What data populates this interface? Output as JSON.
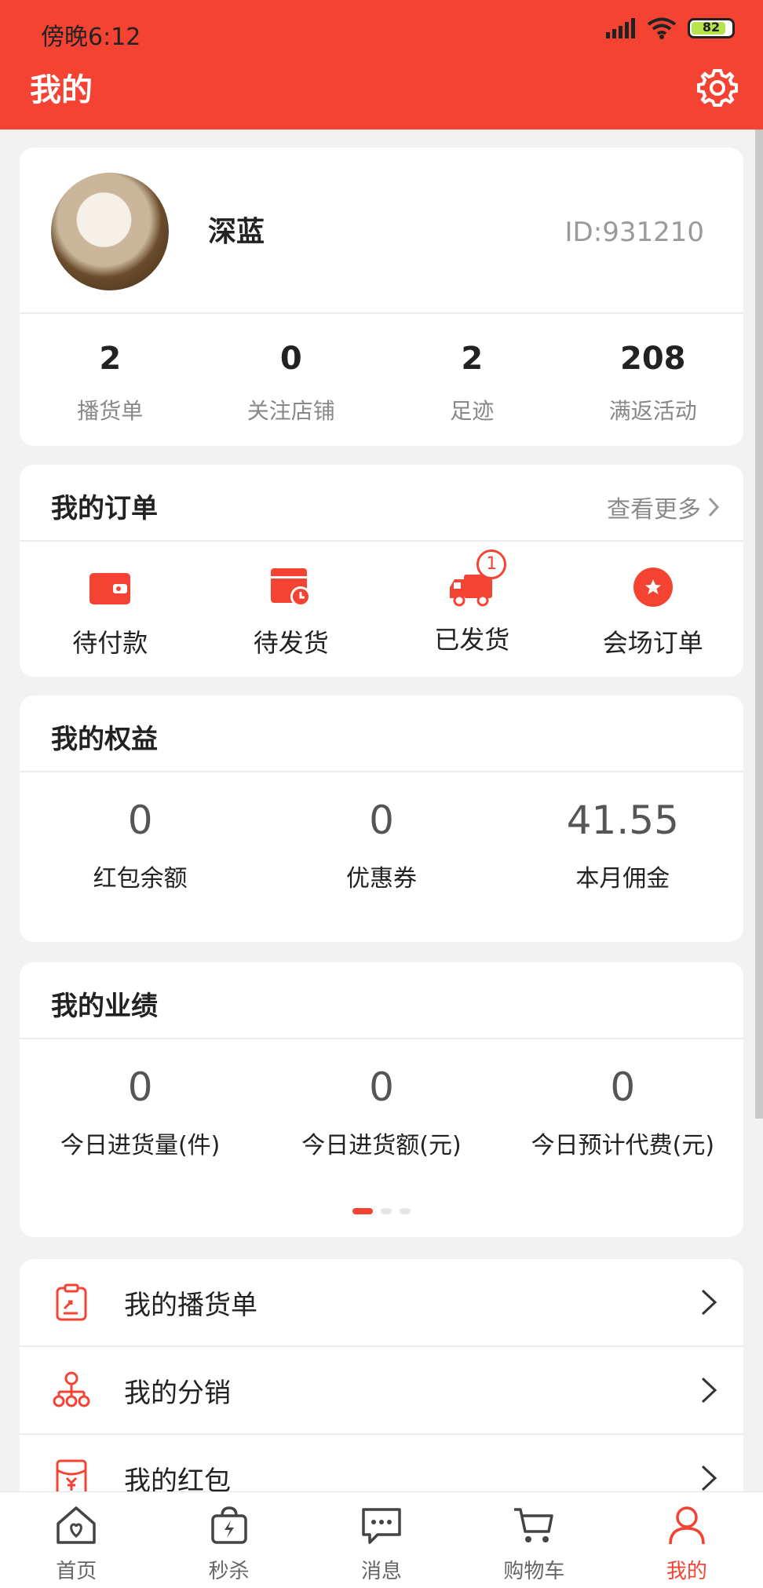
{
  "status_bar": {
    "time": "傍晚6:12",
    "battery": "82"
  },
  "header": {
    "title": "我的"
  },
  "profile": {
    "name": "深蓝",
    "id": "ID:931210",
    "stats": [
      {
        "value": "2",
        "label": "播货单"
      },
      {
        "value": "0",
        "label": "关注店铺"
      },
      {
        "value": "2",
        "label": "足迹"
      },
      {
        "value": "208",
        "label": "满返活动"
      }
    ]
  },
  "orders": {
    "title": "我的订单",
    "more": "查看更多",
    "items": [
      {
        "label": "待付款",
        "icon": "wallet-icon"
      },
      {
        "label": "待发货",
        "icon": "pending-ship-icon"
      },
      {
        "label": "已发货",
        "icon": "truck-icon",
        "badge": "1"
      },
      {
        "label": "会场订单",
        "icon": "star-circle-icon"
      }
    ]
  },
  "rights": {
    "title": "我的权益",
    "items": [
      {
        "value": "0",
        "label": "红包余额"
      },
      {
        "value": "0",
        "label": "优惠券"
      },
      {
        "value": "41.55",
        "label": "本月佣金"
      }
    ]
  },
  "performance": {
    "title": "我的业绩",
    "items": [
      {
        "value": "0",
        "label": "今日进货量(件)"
      },
      {
        "value": "0",
        "label": "今日进货额(元)"
      },
      {
        "value": "0",
        "label": "今日预计代费(元)"
      }
    ]
  },
  "menu": [
    {
      "label": "我的播货单",
      "icon": "clipboard-icon"
    },
    {
      "label": "我的分销",
      "icon": "network-icon"
    },
    {
      "label": "我的红包",
      "icon": "red-packet-icon"
    }
  ],
  "tabbar": [
    {
      "label": "首页",
      "icon": "home-icon"
    },
    {
      "label": "秒杀",
      "icon": "flash-bag-icon"
    },
    {
      "label": "消息",
      "icon": "message-icon"
    },
    {
      "label": "购物车",
      "icon": "cart-icon"
    },
    {
      "label": "我的",
      "icon": "user-icon",
      "active": true
    }
  ],
  "colors": {
    "brand": "#f54333",
    "muted": "#888888"
  }
}
